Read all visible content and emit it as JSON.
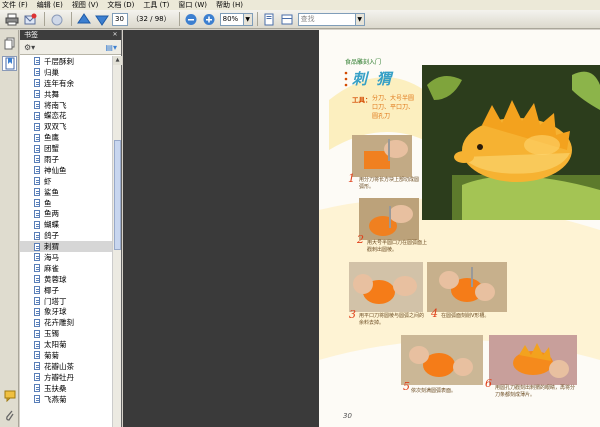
{
  "menu": [
    "文件 (F)",
    "编辑 (E)",
    "视图 (V)",
    "文档 (D)",
    "工具 (T)",
    "窗口 (W)",
    "帮助 (H)"
  ],
  "toolbar": {
    "page_number": "30",
    "page_total": "（32 / 98）",
    "zoom": "80%",
    "search_placeholder": "查找"
  },
  "bookmarks_panel": {
    "title": "书签",
    "items": [
      "千层酥刺",
      "归巢",
      "连年有余",
      "共舞",
      "将南飞",
      "蝶恋花",
      "双双飞",
      "鱼鹰",
      "团蟹",
      "雨子",
      "神仙鱼",
      "虾",
      "鲨鱼",
      "鱼",
      "鱼两",
      "蝴蝶",
      "鸽子",
      "刺猬",
      "海马",
      "麻雀",
      "黄蓉球",
      "椰子",
      "门塔丁",
      "象牙球",
      "花卉雕刻",
      "玉镯",
      "太阳菊",
      "菊菊",
      "花瓣山茶",
      "方瓣牡丹",
      "玉扶桑",
      "飞燕菊"
    ],
    "selected_index": 17
  },
  "page": {
    "header": "食品雕刻入门",
    "title": "刺 猬",
    "tools_label": "工具：",
    "tools_text": "分刀、大号半圆口刀、平口刀、圆孔刀",
    "steps": [
      {
        "n": "1",
        "text": "用分刀将长方块上部切成圆弧形。"
      },
      {
        "n": "2",
        "text": "用大号半圆口刀在圆弧面上戳刺出圆棱。"
      },
      {
        "n": "3",
        "text": "用平口刀将圆棱与圆弧之间的余料去掉。"
      },
      {
        "n": "4",
        "text": "在圆弧面刻削V形槽。"
      },
      {
        "n": "5",
        "text": "依次刻满圆弧表面。"
      },
      {
        "n": "6",
        "text": "用圆孔刀戳刻出刺猬的眼睛，再将分刀条都刻成薄片。"
      }
    ],
    "page_number": "30"
  },
  "colors": {
    "accent": "#36a0c6",
    "step_number": "#e0401a",
    "dark_bg": "#3a3a3a"
  }
}
